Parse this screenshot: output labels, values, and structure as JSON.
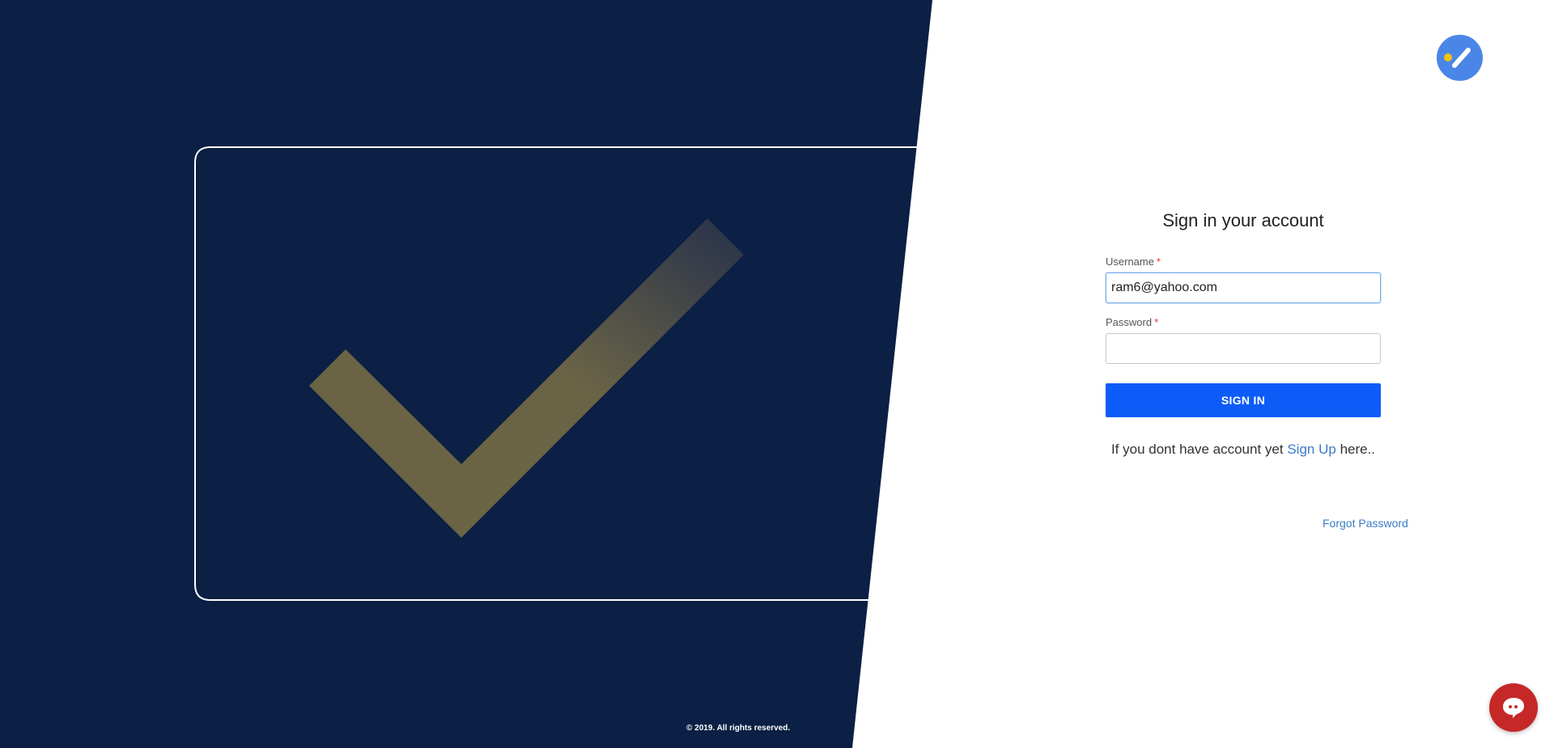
{
  "footer": {
    "copyright": "© 2019. All rights reserved."
  },
  "icons": {
    "logo": "check-stroke-logo-icon",
    "hero": "checkmark-icon",
    "chat": "chat-bubble-icon"
  },
  "colors": {
    "left_panel_bg": "#0c1f44",
    "primary_button": "#0d5cf7",
    "link": "#3a7cc7",
    "required": "#e53935",
    "chat_button": "#c62828",
    "logo_blue": "#4a86e8",
    "logo_yellow": "#f4c20d",
    "checkmark_gold": "#6b6544"
  },
  "form": {
    "title": "Sign in your account",
    "username": {
      "label": "Username",
      "required_mark": "*",
      "value": "ram6@yahoo.com",
      "placeholder": ""
    },
    "password": {
      "label": "Password",
      "required_mark": "*",
      "value": "",
      "placeholder": ""
    },
    "submit_label": "SIGN IN",
    "signup_prefix": "If you dont have account yet",
    "signup_link": "Sign Up",
    "signup_suffix": "here..",
    "forgot_password": "Forgot Password"
  }
}
